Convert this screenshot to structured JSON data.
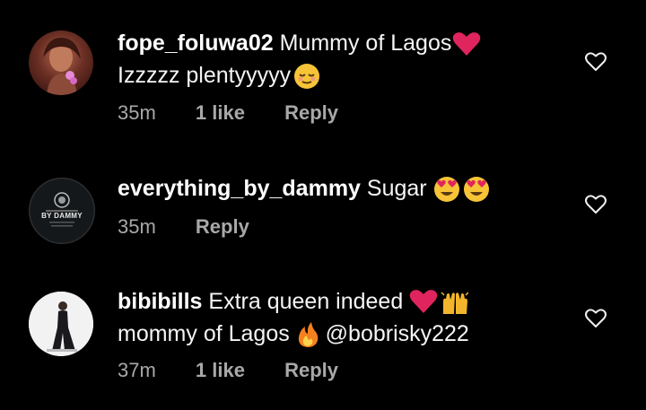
{
  "comments": [
    {
      "username": "fope_foluwa02",
      "line1_text": "Mummy of Lagos",
      "line2_text": "Izzzzz plentyyyyy",
      "time": "35m",
      "likes": "1 like",
      "reply": "Reply"
    },
    {
      "username": "everything_by_dammy",
      "line1_text": "Sugar",
      "time": "35m",
      "reply": "Reply",
      "avatar_text": "BY DAMMY"
    },
    {
      "username": "bibibills",
      "line1_text": "Extra queen indeed",
      "line2_text": "mommy of Lagos",
      "mention": "@bobrisky222",
      "time": "37m",
      "likes": "1 like",
      "reply": "Reply"
    }
  ],
  "colors": {
    "background": "#000000",
    "text": "#f5f5f5",
    "meta": "#a8a8a8",
    "heart_emoji": "#e0245e"
  },
  "icons": [
    "heart-outline-icon",
    "red-heart-emoji",
    "relieved-face-emoji",
    "heart-eyes-emoji",
    "raised-hands-emoji",
    "fire-emoji"
  ]
}
